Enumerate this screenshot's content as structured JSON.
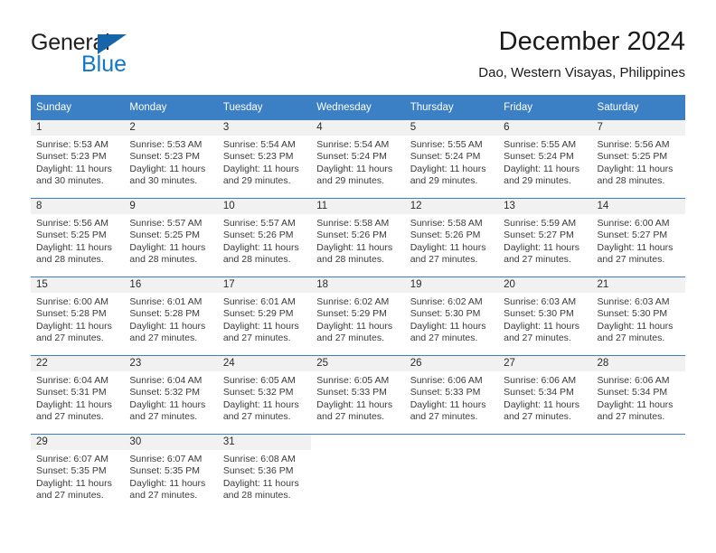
{
  "brand": {
    "name_top": "General",
    "name_bottom": "Blue"
  },
  "header": {
    "title": "December 2024",
    "subtitle": "Dao, Western Visayas, Philippines"
  },
  "colors": {
    "header_blue": "#3b7fc4",
    "daynum_band": "#f1f1f1",
    "logo_blue": "#1277cc",
    "text": "#3a3a3a"
  },
  "weekday_headers": [
    "Sunday",
    "Monday",
    "Tuesday",
    "Wednesday",
    "Thursday",
    "Friday",
    "Saturday"
  ],
  "weeks": [
    [
      {
        "day": "1",
        "sunrise": "Sunrise: 5:53 AM",
        "sunset": "Sunset: 5:23 PM",
        "daylight1": "Daylight: 11 hours",
        "daylight2": "and 30 minutes."
      },
      {
        "day": "2",
        "sunrise": "Sunrise: 5:53 AM",
        "sunset": "Sunset: 5:23 PM",
        "daylight1": "Daylight: 11 hours",
        "daylight2": "and 30 minutes."
      },
      {
        "day": "3",
        "sunrise": "Sunrise: 5:54 AM",
        "sunset": "Sunset: 5:23 PM",
        "daylight1": "Daylight: 11 hours",
        "daylight2": "and 29 minutes."
      },
      {
        "day": "4",
        "sunrise": "Sunrise: 5:54 AM",
        "sunset": "Sunset: 5:24 PM",
        "daylight1": "Daylight: 11 hours",
        "daylight2": "and 29 minutes."
      },
      {
        "day": "5",
        "sunrise": "Sunrise: 5:55 AM",
        "sunset": "Sunset: 5:24 PM",
        "daylight1": "Daylight: 11 hours",
        "daylight2": "and 29 minutes."
      },
      {
        "day": "6",
        "sunrise": "Sunrise: 5:55 AM",
        "sunset": "Sunset: 5:24 PM",
        "daylight1": "Daylight: 11 hours",
        "daylight2": "and 29 minutes."
      },
      {
        "day": "7",
        "sunrise": "Sunrise: 5:56 AM",
        "sunset": "Sunset: 5:25 PM",
        "daylight1": "Daylight: 11 hours",
        "daylight2": "and 28 minutes."
      }
    ],
    [
      {
        "day": "8",
        "sunrise": "Sunrise: 5:56 AM",
        "sunset": "Sunset: 5:25 PM",
        "daylight1": "Daylight: 11 hours",
        "daylight2": "and 28 minutes."
      },
      {
        "day": "9",
        "sunrise": "Sunrise: 5:57 AM",
        "sunset": "Sunset: 5:25 PM",
        "daylight1": "Daylight: 11 hours",
        "daylight2": "and 28 minutes."
      },
      {
        "day": "10",
        "sunrise": "Sunrise: 5:57 AM",
        "sunset": "Sunset: 5:26 PM",
        "daylight1": "Daylight: 11 hours",
        "daylight2": "and 28 minutes."
      },
      {
        "day": "11",
        "sunrise": "Sunrise: 5:58 AM",
        "sunset": "Sunset: 5:26 PM",
        "daylight1": "Daylight: 11 hours",
        "daylight2": "and 28 minutes."
      },
      {
        "day": "12",
        "sunrise": "Sunrise: 5:58 AM",
        "sunset": "Sunset: 5:26 PM",
        "daylight1": "Daylight: 11 hours",
        "daylight2": "and 27 minutes."
      },
      {
        "day": "13",
        "sunrise": "Sunrise: 5:59 AM",
        "sunset": "Sunset: 5:27 PM",
        "daylight1": "Daylight: 11 hours",
        "daylight2": "and 27 minutes."
      },
      {
        "day": "14",
        "sunrise": "Sunrise: 6:00 AM",
        "sunset": "Sunset: 5:27 PM",
        "daylight1": "Daylight: 11 hours",
        "daylight2": "and 27 minutes."
      }
    ],
    [
      {
        "day": "15",
        "sunrise": "Sunrise: 6:00 AM",
        "sunset": "Sunset: 5:28 PM",
        "daylight1": "Daylight: 11 hours",
        "daylight2": "and 27 minutes."
      },
      {
        "day": "16",
        "sunrise": "Sunrise: 6:01 AM",
        "sunset": "Sunset: 5:28 PM",
        "daylight1": "Daylight: 11 hours",
        "daylight2": "and 27 minutes."
      },
      {
        "day": "17",
        "sunrise": "Sunrise: 6:01 AM",
        "sunset": "Sunset: 5:29 PM",
        "daylight1": "Daylight: 11 hours",
        "daylight2": "and 27 minutes."
      },
      {
        "day": "18",
        "sunrise": "Sunrise: 6:02 AM",
        "sunset": "Sunset: 5:29 PM",
        "daylight1": "Daylight: 11 hours",
        "daylight2": "and 27 minutes."
      },
      {
        "day": "19",
        "sunrise": "Sunrise: 6:02 AM",
        "sunset": "Sunset: 5:30 PM",
        "daylight1": "Daylight: 11 hours",
        "daylight2": "and 27 minutes."
      },
      {
        "day": "20",
        "sunrise": "Sunrise: 6:03 AM",
        "sunset": "Sunset: 5:30 PM",
        "daylight1": "Daylight: 11 hours",
        "daylight2": "and 27 minutes."
      },
      {
        "day": "21",
        "sunrise": "Sunrise: 6:03 AM",
        "sunset": "Sunset: 5:30 PM",
        "daylight1": "Daylight: 11 hours",
        "daylight2": "and 27 minutes."
      }
    ],
    [
      {
        "day": "22",
        "sunrise": "Sunrise: 6:04 AM",
        "sunset": "Sunset: 5:31 PM",
        "daylight1": "Daylight: 11 hours",
        "daylight2": "and 27 minutes."
      },
      {
        "day": "23",
        "sunrise": "Sunrise: 6:04 AM",
        "sunset": "Sunset: 5:32 PM",
        "daylight1": "Daylight: 11 hours",
        "daylight2": "and 27 minutes."
      },
      {
        "day": "24",
        "sunrise": "Sunrise: 6:05 AM",
        "sunset": "Sunset: 5:32 PM",
        "daylight1": "Daylight: 11 hours",
        "daylight2": "and 27 minutes."
      },
      {
        "day": "25",
        "sunrise": "Sunrise: 6:05 AM",
        "sunset": "Sunset: 5:33 PM",
        "daylight1": "Daylight: 11 hours",
        "daylight2": "and 27 minutes."
      },
      {
        "day": "26",
        "sunrise": "Sunrise: 6:06 AM",
        "sunset": "Sunset: 5:33 PM",
        "daylight1": "Daylight: 11 hours",
        "daylight2": "and 27 minutes."
      },
      {
        "day": "27",
        "sunrise": "Sunrise: 6:06 AM",
        "sunset": "Sunset: 5:34 PM",
        "daylight1": "Daylight: 11 hours",
        "daylight2": "and 27 minutes."
      },
      {
        "day": "28",
        "sunrise": "Sunrise: 6:06 AM",
        "sunset": "Sunset: 5:34 PM",
        "daylight1": "Daylight: 11 hours",
        "daylight2": "and 27 minutes."
      }
    ],
    [
      {
        "day": "29",
        "sunrise": "Sunrise: 6:07 AM",
        "sunset": "Sunset: 5:35 PM",
        "daylight1": "Daylight: 11 hours",
        "daylight2": "and 27 minutes."
      },
      {
        "day": "30",
        "sunrise": "Sunrise: 6:07 AM",
        "sunset": "Sunset: 5:35 PM",
        "daylight1": "Daylight: 11 hours",
        "daylight2": "and 27 minutes."
      },
      {
        "day": "31",
        "sunrise": "Sunrise: 6:08 AM",
        "sunset": "Sunset: 5:36 PM",
        "daylight1": "Daylight: 11 hours",
        "daylight2": "and 28 minutes."
      },
      {
        "day": "",
        "sunrise": "",
        "sunset": "",
        "daylight1": "",
        "daylight2": ""
      },
      {
        "day": "",
        "sunrise": "",
        "sunset": "",
        "daylight1": "",
        "daylight2": ""
      },
      {
        "day": "",
        "sunrise": "",
        "sunset": "",
        "daylight1": "",
        "daylight2": ""
      },
      {
        "day": "",
        "sunrise": "",
        "sunset": "",
        "daylight1": "",
        "daylight2": ""
      }
    ]
  ]
}
